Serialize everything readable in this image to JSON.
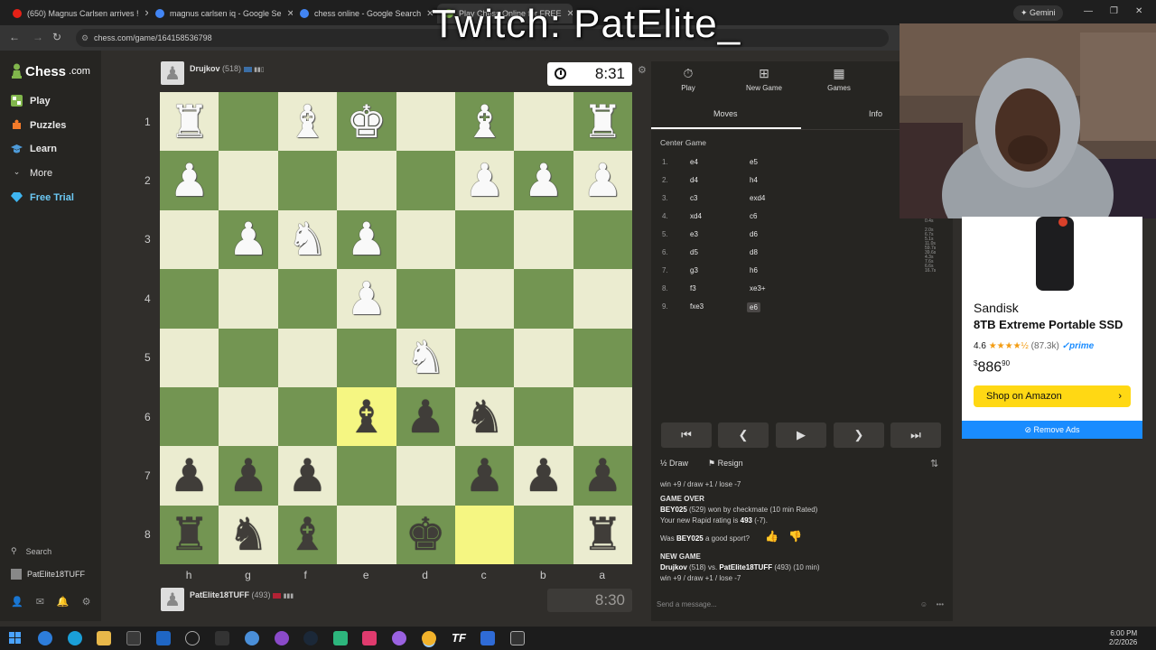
{
  "browser": {
    "tabs": [
      {
        "label": "(650) Magnus Carlsen arrives !",
        "color": "#e62117"
      },
      {
        "label": "magnus carlsen iq - Google Se",
        "color": "#4285f4"
      },
      {
        "label": "chess online - Google Search",
        "color": "#4285f4"
      },
      {
        "label": "Play Chess Online for FREE",
        "color": "#81b64c"
      }
    ],
    "url": "chess.com/game/164158536798",
    "gemini": "Gemini"
  },
  "overlay": {
    "title": "Twitch: PatElite_"
  },
  "sidebar": {
    "logo": "Chess",
    "logo_suffix": ".com",
    "items": [
      {
        "label": "Play"
      },
      {
        "label": "Puzzles"
      },
      {
        "label": "Learn"
      },
      {
        "label": "More"
      },
      {
        "label": "Free Trial"
      }
    ],
    "search": "Search",
    "username": "PatElite18TUFF"
  },
  "game": {
    "top_player": {
      "name": "Drujkov",
      "rating": "(518)",
      "clock": "8:31"
    },
    "bottom_player": {
      "name": "PatElite18TUFF",
      "rating": "(493)",
      "clock": "8:30"
    },
    "ranks": [
      "1",
      "2",
      "3",
      "4",
      "5",
      "6",
      "7",
      "8"
    ],
    "files": [
      "h",
      "g",
      "f",
      "e",
      "d",
      "c",
      "b",
      "a"
    ],
    "board": [
      [
        "wR",
        "",
        "wB",
        "wK",
        "",
        "wB",
        "",
        "wR"
      ],
      [
        "wP",
        "",
        "",
        "",
        "",
        "wP",
        "wP",
        "wP"
      ],
      [
        "",
        "wP",
        "wN",
        "wP",
        "",
        "",
        "",
        ""
      ],
      [
        "",
        "",
        "",
        "wP",
        "",
        "",
        "",
        ""
      ],
      [
        "",
        "",
        "",
        "",
        "wN",
        "",
        "",
        ""
      ],
      [
        "",
        "",
        "",
        "bB",
        "bP",
        "bN",
        "",
        ""
      ],
      [
        "bP",
        "bP",
        "bP",
        "",
        "",
        "bP",
        "bP",
        "bP"
      ],
      [
        "bR",
        "bN",
        "bB",
        "",
        "bK",
        "",
        "",
        "bR"
      ]
    ],
    "highlighted": [
      [
        5,
        3
      ],
      [
        7,
        5
      ]
    ]
  },
  "panel": {
    "tabs": [
      {
        "label": "Play",
        "icon": "stopwatch-icon"
      },
      {
        "label": "New Game",
        "icon": "plus-icon"
      },
      {
        "label": "Games",
        "icon": "grid-icon"
      }
    ],
    "subtabs": {
      "moves": "Moves",
      "info": "Info"
    },
    "opening": "Center Game",
    "moves": [
      {
        "n": "1.",
        "w": "e4",
        "b": "e5"
      },
      {
        "n": "2.",
        "w": "d4",
        "b": "h4"
      },
      {
        "n": "3.",
        "w": "c3",
        "b": "exd4"
      },
      {
        "n": "4.",
        "w": "xd4",
        "b": "c6"
      },
      {
        "n": "5.",
        "w": "e3",
        "b": "d6"
      },
      {
        "n": "6.",
        "w": "d5",
        "b": "d8"
      },
      {
        "n": "7.",
        "w": "g3",
        "b": "h6"
      },
      {
        "n": "8.",
        "w": "f3",
        "b": "xe3+"
      },
      {
        "n": "9.",
        "w": "fxe3",
        "b": "e6"
      }
    ],
    "times": [
      [
        "0.4s",
        ""
      ],
      [
        "2.0s",
        "6.7s"
      ],
      [
        "5.1s",
        "11.0s"
      ],
      [
        "59.7s",
        "39.6s"
      ],
      [
        "4.3s",
        "7.6s"
      ],
      [
        "6.6s",
        "16.7s"
      ]
    ],
    "draw": "Draw",
    "resign": "Resign",
    "chat": {
      "l1": "win +9 / draw +1 / lose -7",
      "gameover_title": "GAME OVER",
      "winner": "BEY025",
      "winner_rating": "(529)",
      "result": "won by checkmate (10 min Rated)",
      "new_rating_prefix": "Your new Rapid rating is",
      "new_rating": "493",
      "new_rating_suffix": "(-7).",
      "sport_q_prefix": "Was",
      "sport_q_name": "BEY025",
      "sport_q_suffix": "a good sport?",
      "newgame_title": "NEW GAME",
      "ng_p1": "Drujkov",
      "ng_p1r": "(518)",
      "ng_vs": "vs.",
      "ng_p2": "PatElite18TUFF",
      "ng_p2r": "(493) (10 min)",
      "l2": "win +9 / draw +1 / lose -7"
    },
    "message_placeholder": "Send a message..."
  },
  "ad": {
    "brand": "Sandisk",
    "product": "8TB Extreme Portable SSD",
    "rating": "4.6",
    "stars": "★★★★½",
    "count": "(87.3k)",
    "prime": "✓prime",
    "price": "886",
    "price_cents": "90",
    "currency": "$",
    "button": "Shop on Amazon",
    "remove": "Remove Ads"
  },
  "taskbar": {
    "time": "6:00 PM",
    "date": "2/2/2026"
  },
  "colors": {
    "light": "#ebecd0",
    "dark": "#739552",
    "highlight": "#f5f682",
    "accent": "#81b64c"
  }
}
